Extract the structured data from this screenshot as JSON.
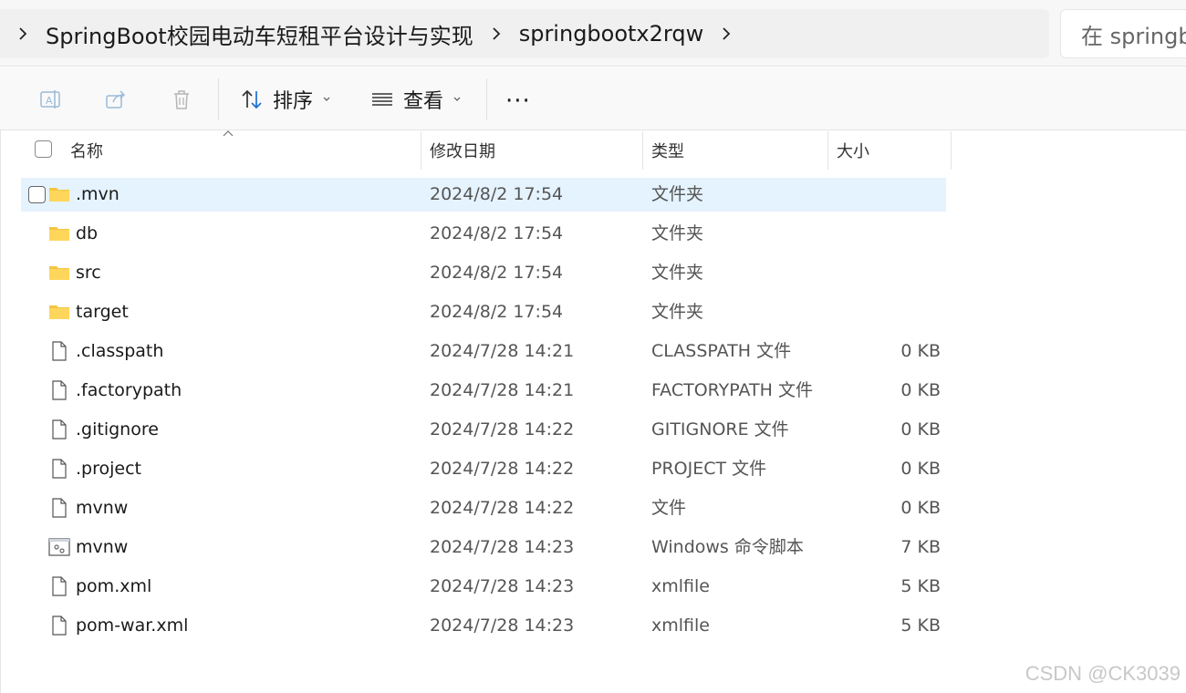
{
  "address_bar": {
    "crumbs": [
      "SpringBoot校园电动车短租平台设计与实现",
      "springbootx2rqw"
    ],
    "search_placeholder": "在 springb"
  },
  "toolbar": {
    "sort_label": "排序",
    "view_label": "查看",
    "more_label": "···"
  },
  "columns": {
    "name": "名称",
    "date": "修改日期",
    "type": "类型",
    "size": "大小"
  },
  "files": [
    {
      "name": ".mvn",
      "date": "2024/8/2 17:54",
      "type": "文件夹",
      "size": "",
      "icon": "folder-icon",
      "selected": true
    },
    {
      "name": "db",
      "date": "2024/8/2 17:54",
      "type": "文件夹",
      "size": "",
      "icon": "folder-icon"
    },
    {
      "name": "src",
      "date": "2024/8/2 17:54",
      "type": "文件夹",
      "size": "",
      "icon": "folder-icon"
    },
    {
      "name": "target",
      "date": "2024/8/2 17:54",
      "type": "文件夹",
      "size": "",
      "icon": "folder-icon"
    },
    {
      "name": ".classpath",
      "date": "2024/7/28 14:21",
      "type": "CLASSPATH 文件",
      "size": "0 KB",
      "icon": "file-icon"
    },
    {
      "name": ".factorypath",
      "date": "2024/7/28 14:21",
      "type": "FACTORYPATH 文件",
      "size": "0 KB",
      "icon": "file-icon"
    },
    {
      "name": ".gitignore",
      "date": "2024/7/28 14:22",
      "type": "GITIGNORE 文件",
      "size": "0 KB",
      "icon": "file-icon"
    },
    {
      "name": ".project",
      "date": "2024/7/28 14:22",
      "type": "PROJECT 文件",
      "size": "0 KB",
      "icon": "file-icon"
    },
    {
      "name": "mvnw",
      "date": "2024/7/28 14:22",
      "type": "文件",
      "size": "0 KB",
      "icon": "file-icon"
    },
    {
      "name": "mvnw",
      "date": "2024/7/28 14:23",
      "type": "Windows 命令脚本",
      "size": "7 KB",
      "icon": "script-icon"
    },
    {
      "name": "pom.xml",
      "date": "2024/7/28 14:23",
      "type": "xmlfile",
      "size": "5 KB",
      "icon": "file-icon"
    },
    {
      "name": "pom-war.xml",
      "date": "2024/7/28 14:23",
      "type": "xmlfile",
      "size": "5 KB",
      "icon": "file-icon"
    }
  ],
  "watermark": "CSDN @CK3039"
}
